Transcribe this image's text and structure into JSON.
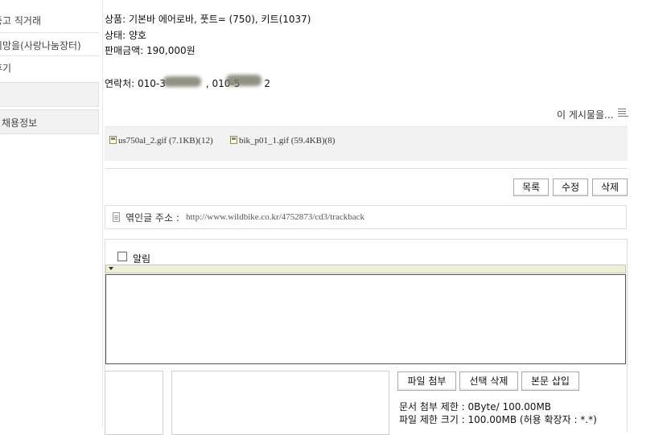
{
  "sidebar": {
    "items": [
      {
        "label": "중고 직거래"
      },
      {
        "label": "희망을(사랑나눔장터)"
      },
      {
        "label": "후기"
      },
      {
        "label": ""
      },
      {
        "label": "채용정보"
      }
    ]
  },
  "post": {
    "product_line": "상품: 기본바 에어로바, 풋트= (750), 키트(1037)",
    "status_line": "상태: 양호",
    "price_line": "판매금액: 190,000원",
    "contact_prefix": "연락처: 010-3",
    "contact_mid": ", 010-5",
    "contact_suffix": "2"
  },
  "post_menu": {
    "label": "이 게시물을..."
  },
  "attachments": [
    {
      "name": "us750al_2.gif (7.1KB)(12)"
    },
    {
      "name": "bik_p01_1.gif (59.4KB)(8)"
    }
  ],
  "actions": {
    "list": "목록",
    "edit": "수정",
    "delete": "삭제"
  },
  "trackback": {
    "label": "엮인글 주소 :",
    "url": "http://www.wildbike.co.kr/4752873/cd3/trackback"
  },
  "comment": {
    "notify_label": "알림",
    "attach_button": "파일 첨부",
    "delete_selected_button": "선택 삭제",
    "insert_button": "본문 삽입",
    "doc_limit": "문서 첨부 제한 : 0Byte/ 100.00MB",
    "file_limit": "파일 제한 크기 : 100.00MB (허용 확장자 : *.*)"
  },
  "colors": {
    "sidebar_box": "#f2f2f2",
    "attach_bar": "#f2f2f2",
    "toolbar_strip": "#efefd8"
  }
}
